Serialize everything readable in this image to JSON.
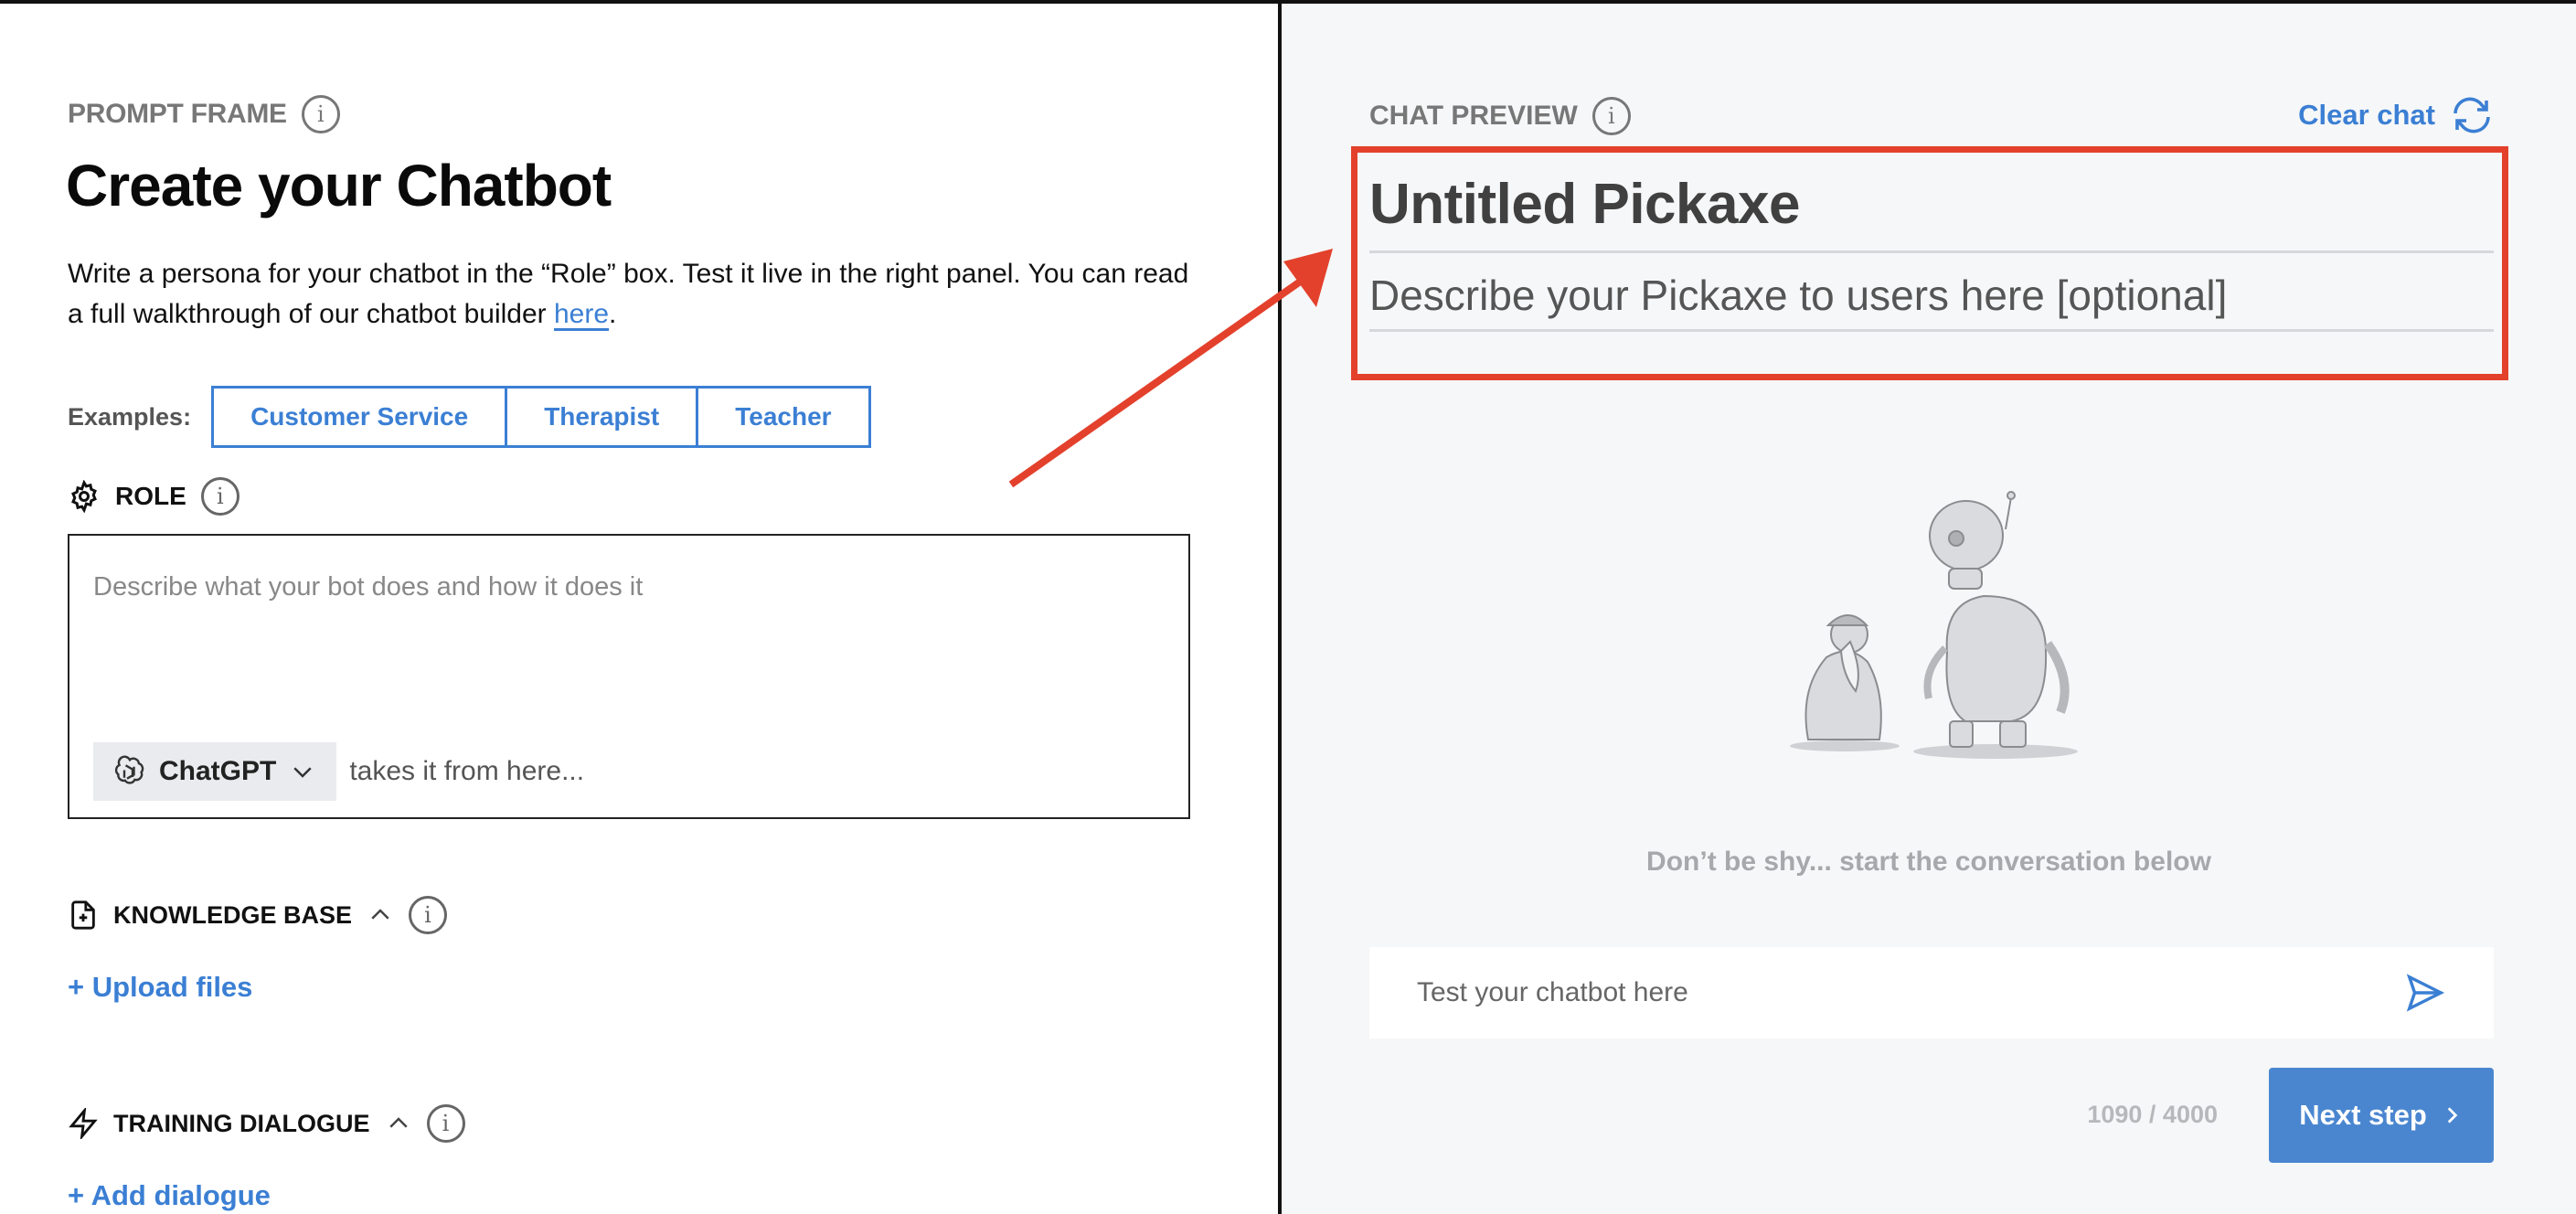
{
  "left_panel": {
    "frame_label": "PROMPT FRAME",
    "title": "Create your Chatbot",
    "intro_text": "Write a persona for your chatbot in the “Role” box. Test it live in the right panel. You can read a full walkthrough of our chatbot builder ",
    "intro_link": "here",
    "intro_end": ".",
    "examples": {
      "label": "Examples:",
      "buttons": [
        "Customer Service",
        "Therapist",
        "Teacher"
      ]
    },
    "role": {
      "label": "ROLE",
      "placeholder": "Describe what your bot does and how it does it",
      "model": "ChatGPT",
      "model_suffix": "takes it from here..."
    },
    "knowledge_base": {
      "label": "KNOWLEDGE BASE",
      "upload_link": "+ Upload files"
    },
    "training_dialogue": {
      "label": "TRAINING DIALOGUE",
      "add_link": "+ Add dialogue"
    }
  },
  "right_panel": {
    "preview_label": "CHAT PREVIEW",
    "clear_chat": "Clear chat",
    "bot_title": "Untitled Pickaxe",
    "bot_description": "Describe your Pickaxe to users here [optional]",
    "empty_message": "Don’t be shy... start the conversation below",
    "chat_placeholder": "Test your chatbot here",
    "counter": "1090 / 4000",
    "next_button": "Next step"
  },
  "colors": {
    "accent": "#3b7fd4",
    "highlight": "#e3412c",
    "preview_bg": "#f6f7f8"
  }
}
